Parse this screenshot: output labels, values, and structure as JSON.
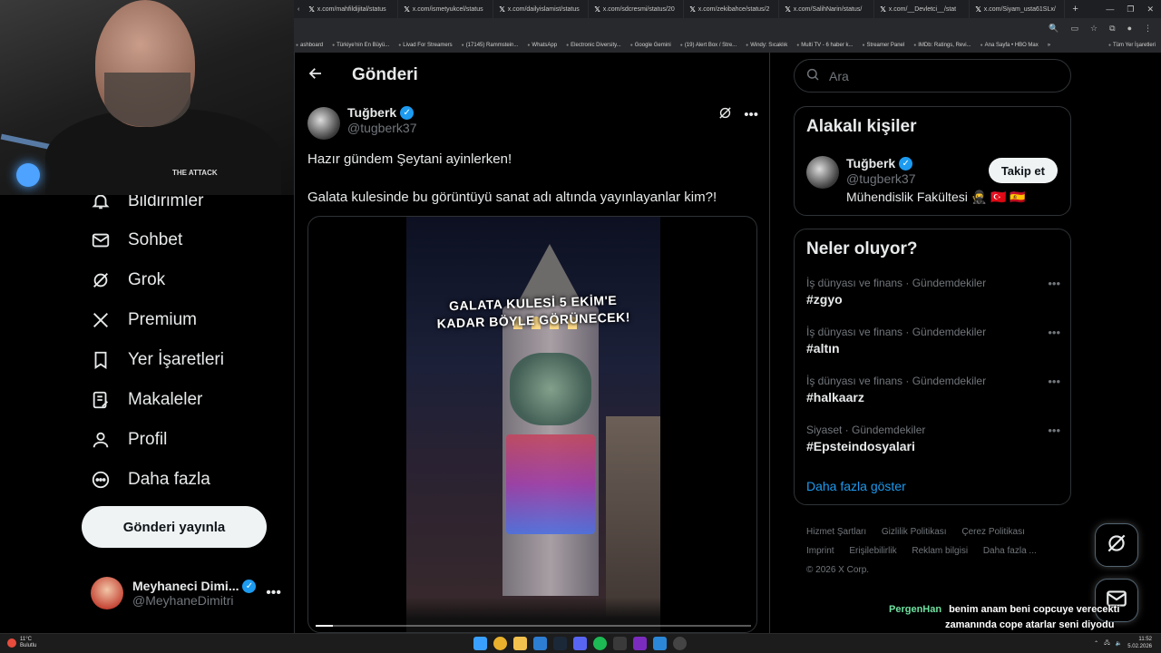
{
  "browser": {
    "tabs": [
      {
        "label": "x.com/mahfildijital/status"
      },
      {
        "label": "x.com/ismetyukcel/status"
      },
      {
        "label": "x.com/dailyislamist/status"
      },
      {
        "label": "x.com/sdcresmi/status/20"
      },
      {
        "label": "x.com/zekibahce/status/2"
      },
      {
        "label": "x.com/SalihNarin/status/"
      },
      {
        "label": "x.com/__Devletci__/stat"
      },
      {
        "label": "x.com/Siyam_usta61SLx/"
      }
    ],
    "bookmarks": [
      "ashboard",
      "Türkiye'nin En Büyü...",
      "Livad For Streamers",
      "(17145) Rammstein...",
      "WhatsApp",
      "Electronic Diversity...",
      "Google Gemini",
      "(19) Alert Box / Stre...",
      "Windy: Sıcaklık",
      "Multi TV - 6 haber k...",
      "Streamer Panel",
      "IMDb: Ratings, Revi...",
      "Ana Sayfa • HBO Max",
      "Tüm Yer İşaretleri"
    ]
  },
  "webcam": {
    "badge": "THE ATTACK"
  },
  "sidebar": {
    "items": [
      {
        "label": "Bildirimler",
        "icon": "bell-icon"
      },
      {
        "label": "Sohbet",
        "icon": "mail-icon"
      },
      {
        "label": "Grok",
        "icon": "grok-icon"
      },
      {
        "label": "Premium",
        "icon": "x-logo-icon"
      },
      {
        "label": "Yer İşaretleri",
        "icon": "bookmark-icon"
      },
      {
        "label": "Makaleler",
        "icon": "article-icon"
      },
      {
        "label": "Profil",
        "icon": "person-icon"
      },
      {
        "label": "Daha fazla",
        "icon": "more-circle-icon"
      }
    ],
    "post_button": "Gönderi yayınla",
    "account": {
      "display_name": "Meyhaneci Dimi...",
      "handle": "@MeyhaneDimitri"
    }
  },
  "main": {
    "title": "Gönderi",
    "post": {
      "author": "Tuğberk",
      "handle": "@tugberk37",
      "paragraphs": [
        "Hazır gündem Şeytani ayinlerken!",
        "Galata kulesinde bu görüntüyü sanat adı altında yayınlayanlar kim?!"
      ],
      "video_caption_line1": "GALATA KULESİ 5 EKİM'E",
      "video_caption_line2": "KADAR BÖYLE GÖRÜNECEK!",
      "progress": 0.04
    }
  },
  "right": {
    "search_placeholder": "Ara",
    "related": {
      "title": "Alakalı kişiler",
      "user": {
        "display_name": "Tuğberk",
        "handle": "@tugberk37",
        "bio": "Mühendislik Fakültesi 🥷 🇹🇷 🇪🇸"
      },
      "follow_label": "Takip et"
    },
    "trends": {
      "title": "Neler oluyor?",
      "items": [
        {
          "meta": "İş dünyası ve finans · Gündemdekiler",
          "tag": "#zgyo"
        },
        {
          "meta": "İş dünyası ve finans · Gündemdekiler",
          "tag": "#altın"
        },
        {
          "meta": "İş dünyası ve finans · Gündemdekiler",
          "tag": "#halkaarz"
        },
        {
          "meta": "Siyaset · Gündemdekiler",
          "tag": "#Epsteindosyalari"
        }
      ],
      "show_more": "Daha fazla göster"
    },
    "footer": {
      "links": [
        "Hizmet Şartları",
        "Gizlilik Politikası",
        "Çerez Politikası",
        "Imprint",
        "Erişilebilirlik",
        "Reklam bilgisi",
        "Daha fazla ..."
      ],
      "copyright": "© 2026 X Corp."
    }
  },
  "chat": {
    "user": "PergenHan",
    "line1": "benim anam beni copcuye verecekti",
    "line2": "zamanında cope atarlar seni diyodu XD"
  },
  "taskbar": {
    "weather_temp": "11°C",
    "weather_desc": "Bulutlu",
    "time": "11:52",
    "date": "5.02.2026"
  },
  "colors": {
    "accent": "#1d9bf0",
    "background": "#000000",
    "border": "#2f3336",
    "muted": "#71767b"
  }
}
